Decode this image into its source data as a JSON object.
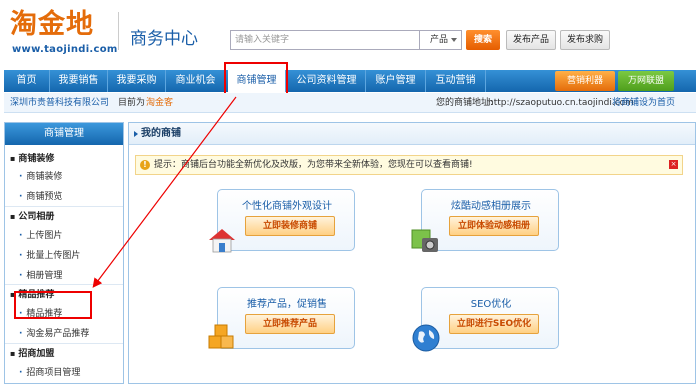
{
  "header": {
    "logo_title": "淘金地",
    "logo_url": "www.taojindi.com",
    "title": "商务中心",
    "search_placeholder": "请输入关键字",
    "search_scope": "产品",
    "search_button": "搜索",
    "post_product": "发布产品",
    "post_request": "发布求购"
  },
  "nav": {
    "items": [
      {
        "label": "首页"
      },
      {
        "label": "我要销售"
      },
      {
        "label": "我要采购"
      },
      {
        "label": "商业机会"
      },
      {
        "label": "商铺管理"
      },
      {
        "label": "公司资料管理"
      },
      {
        "label": "账户管理"
      },
      {
        "label": "互动营销"
      }
    ],
    "active_label": "商铺管理",
    "btn_orange": "营销利器",
    "btn_green": "万网联盟"
  },
  "infobar": {
    "company": "深圳市贵普科技有限公司",
    "current_label": "目前为",
    "current_value": "淘金客",
    "address_label": "您的商铺地址:",
    "address_value": "http://szaoputuo.cn.taojindi.com",
    "set_home": "将商铺设为首页"
  },
  "sidebar": {
    "title": "商铺管理",
    "sections": [
      {
        "label": "商铺装修",
        "items": [
          "商铺装修",
          "商铺预览"
        ]
      },
      {
        "label": "公司相册",
        "items": [
          "上传图片",
          "批量上传图片",
          "相册管理"
        ]
      },
      {
        "label": "精品推荐",
        "items": [
          "精品推荐",
          "淘金易产品推荐"
        ]
      },
      {
        "label": "招商加盟",
        "items": [
          "招商项目管理"
        ]
      }
    ]
  },
  "content": {
    "title": "我的商铺",
    "tip": "提示：商铺后台功能全新优化及改版，为您带来全新体验，您现在可以查看商铺!",
    "tip_icon": "!",
    "tip_close": "×",
    "cards": [
      {
        "title": "个性化商铺外观设计",
        "button": "立即装修商铺",
        "icon": "house-icon"
      },
      {
        "title": "炫酷动感相册展示",
        "button": "立即体验动感相册",
        "icon": "photo-album-icon"
      },
      {
        "title": "推荐产品，促销售",
        "button": "立即推荐产品",
        "icon": "boxes-icon"
      },
      {
        "title": "SEO优化",
        "button": "立即进行SEO优化",
        "icon": "globe-icon"
      }
    ]
  },
  "colors": {
    "brand_blue": "#1466ad",
    "brand_orange": "#e46c0a",
    "annotation_red": "#e00"
  }
}
